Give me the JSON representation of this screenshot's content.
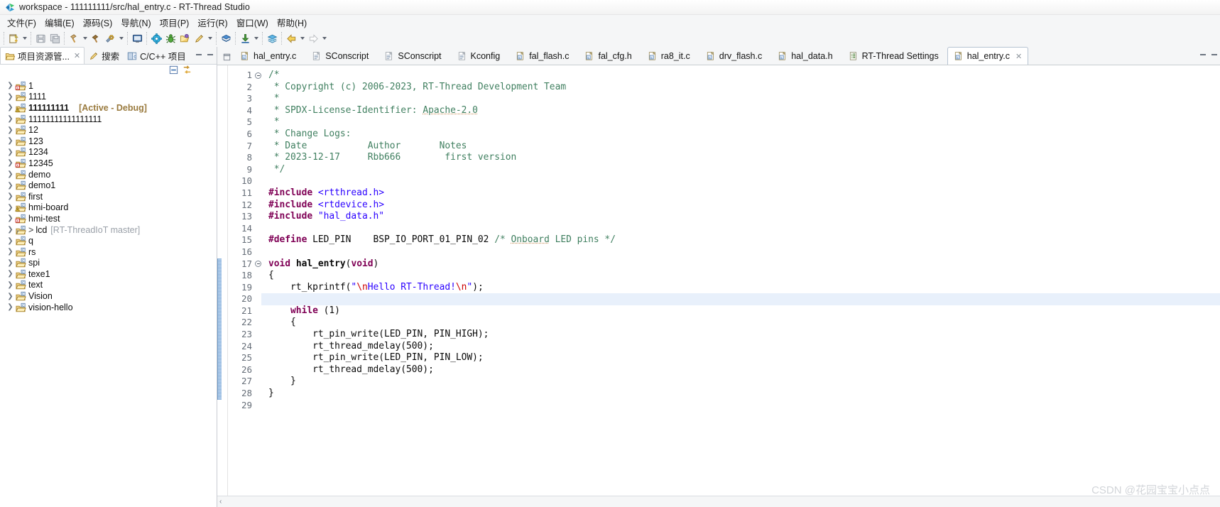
{
  "window": {
    "title": "workspace - 111111111/src/hal_entry.c - RT-Thread Studio",
    "logo_name": "rt-thread-logo-icon"
  },
  "menubar": {
    "items": [
      {
        "label": "文件(F)",
        "name": "menu-file"
      },
      {
        "label": "编辑(E)",
        "name": "menu-edit"
      },
      {
        "label": "源码(S)",
        "name": "menu-source"
      },
      {
        "label": "导航(N)",
        "name": "menu-navigate"
      },
      {
        "label": "项目(P)",
        "name": "menu-project"
      },
      {
        "label": "运行(R)",
        "name": "menu-run"
      },
      {
        "label": "窗口(W)",
        "name": "menu-window"
      },
      {
        "label": "帮助(H)",
        "name": "menu-help"
      }
    ]
  },
  "toolbar": {
    "groups": [
      {
        "buttons": [
          {
            "icon": "new-file-icon",
            "arrow": true
          }
        ]
      },
      {
        "buttons": [
          {
            "icon": "save-icon",
            "arrow": false
          },
          {
            "icon": "save-all-icon",
            "arrow": false
          }
        ]
      },
      {
        "buttons": [
          {
            "icon": "build-hammer-icon",
            "arrow": true
          },
          {
            "icon": "clean-hammer-icon",
            "arrow": false
          },
          {
            "icon": "build-config-icon",
            "arrow": true
          }
        ]
      },
      {
        "buttons": [
          {
            "icon": "terminal-icon",
            "arrow": false
          }
        ]
      },
      {
        "buttons": [
          {
            "icon": "settings-gear-icon",
            "arrow": false
          },
          {
            "icon": "debug-bug-icon",
            "arrow": false
          },
          {
            "icon": "open-package-icon",
            "arrow": false
          },
          {
            "icon": "flash-pen-icon",
            "arrow": true
          }
        ]
      },
      {
        "buttons": [
          {
            "icon": "sdk-manager-icon",
            "arrow": false
          }
        ]
      },
      {
        "buttons": [
          {
            "icon": "download-icon",
            "arrow": true
          }
        ]
      },
      {
        "buttons": [
          {
            "icon": "layers-icon",
            "arrow": false
          }
        ]
      },
      {
        "buttons": [
          {
            "icon": "back-arrow-icon",
            "arrow": true
          },
          {
            "icon": "forward-arrow-icon",
            "arrow": true
          }
        ]
      }
    ]
  },
  "left_pane": {
    "view_tabs": [
      {
        "label": "项目资源管...",
        "icon": "project-explorer-icon",
        "active": true,
        "closable": true
      },
      {
        "label": "搜索",
        "icon": "search-icon",
        "active": false,
        "closable": false
      },
      {
        "label": "C/C++ 项目",
        "icon": "cpp-projects-icon",
        "active": false,
        "closable": false
      }
    ],
    "view_toolbar": [
      {
        "name": "collapse-all-icon"
      },
      {
        "name": "link-with-editor-icon"
      }
    ],
    "minimize_label": "—",
    "tree": [
      {
        "label": "1",
        "icon": "project-error-icon",
        "bold": false,
        "extra": "",
        "prefix": ""
      },
      {
        "label": "1111",
        "icon": "project-icon",
        "bold": false,
        "extra": "",
        "prefix": ""
      },
      {
        "label": "111111111",
        "icon": "project-warning-icon",
        "bold": true,
        "extra": "[Active - Debug]",
        "prefix": ""
      },
      {
        "label": "11111111111111111",
        "icon": "project-icon",
        "bold": false,
        "extra": "",
        "prefix": ""
      },
      {
        "label": "12",
        "icon": "project-icon",
        "bold": false,
        "extra": "",
        "prefix": ""
      },
      {
        "label": "123",
        "icon": "project-icon",
        "bold": false,
        "extra": "",
        "prefix": ""
      },
      {
        "label": "1234",
        "icon": "project-icon",
        "bold": false,
        "extra": "",
        "prefix": ""
      },
      {
        "label": "12345",
        "icon": "project-error-icon",
        "bold": false,
        "extra": "",
        "prefix": ""
      },
      {
        "label": "demo",
        "icon": "project-icon",
        "bold": false,
        "extra": "",
        "prefix": ""
      },
      {
        "label": "demo1",
        "icon": "project-icon",
        "bold": false,
        "extra": "",
        "prefix": ""
      },
      {
        "label": "first",
        "icon": "project-icon",
        "bold": false,
        "extra": "",
        "prefix": ""
      },
      {
        "label": "hmi-board",
        "icon": "project-warning-icon",
        "bold": false,
        "extra": "",
        "prefix": ""
      },
      {
        "label": "hmi-test",
        "icon": "project-error-icon",
        "bold": false,
        "extra": "",
        "prefix": ""
      },
      {
        "label": "lcd",
        "icon": "project-question-icon",
        "bold": false,
        "extra": "[RT-ThreadIoT master]",
        "extra_plain": true,
        "prefix": ">"
      },
      {
        "label": "q",
        "icon": "project-icon",
        "bold": false,
        "extra": "",
        "prefix": ""
      },
      {
        "label": "rs",
        "icon": "project-icon",
        "bold": false,
        "extra": "",
        "prefix": ""
      },
      {
        "label": "spi",
        "icon": "project-icon",
        "bold": false,
        "extra": "",
        "prefix": ""
      },
      {
        "label": "texe1",
        "icon": "project-icon",
        "bold": false,
        "extra": "",
        "prefix": ""
      },
      {
        "label": "text",
        "icon": "project-icon",
        "bold": false,
        "extra": "",
        "prefix": ""
      },
      {
        "label": "Vision",
        "icon": "project-icon",
        "bold": false,
        "extra": "",
        "prefix": ""
      },
      {
        "label": "vision-hello",
        "icon": "project-icon",
        "bold": false,
        "extra": "",
        "prefix": ""
      }
    ]
  },
  "editor": {
    "tabs": [
      {
        "label": "hal_entry.c",
        "icon": "c-file-icon",
        "active": false,
        "closable": false
      },
      {
        "label": "SConscript",
        "icon": "text-file-icon",
        "active": false,
        "closable": false
      },
      {
        "label": "SConscript",
        "icon": "text-file-icon",
        "active": false,
        "closable": false
      },
      {
        "label": "Kconfig",
        "icon": "text-file-icon",
        "active": false,
        "closable": false
      },
      {
        "label": "fal_flash.c",
        "icon": "c-file-icon",
        "active": false,
        "closable": false
      },
      {
        "label": "fal_cfg.h",
        "icon": "c-file-icon",
        "active": false,
        "closable": false
      },
      {
        "label": "ra8_it.c",
        "icon": "c-file-icon",
        "active": false,
        "closable": false
      },
      {
        "label": "drv_flash.c",
        "icon": "c-file-icon",
        "active": false,
        "closable": false
      },
      {
        "label": "hal_data.h",
        "icon": "c-file-icon",
        "active": false,
        "closable": false
      },
      {
        "label": "RT-Thread Settings",
        "icon": "settings-file-icon",
        "active": false,
        "closable": false
      },
      {
        "label": "hal_entry.c",
        "icon": "c-file-icon",
        "active": true,
        "closable": true
      }
    ],
    "current_line": 20,
    "first_line": 1,
    "last_line": 29,
    "scope_from_line": 17,
    "scope_to_line": 28,
    "fold_markers": [
      1,
      17
    ],
    "lines": [
      {
        "n": 1,
        "tokens": [
          {
            "t": "/*",
            "c": "c-comment"
          }
        ]
      },
      {
        "n": 2,
        "tokens": [
          {
            "t": " * Copyright (c) 2006-2023, RT-Thread Development Team",
            "c": "c-comment"
          }
        ]
      },
      {
        "n": 3,
        "tokens": [
          {
            "t": " *",
            "c": "c-comment"
          }
        ]
      },
      {
        "n": 4,
        "tokens": [
          {
            "t": " * SPDX-License-Identifier: ",
            "c": "c-comment"
          },
          {
            "t": "Apache-2.0",
            "c": "c-comment-u"
          }
        ]
      },
      {
        "n": 5,
        "tokens": [
          {
            "t": " *",
            "c": "c-comment"
          }
        ]
      },
      {
        "n": 6,
        "tokens": [
          {
            "t": " * Change Logs:",
            "c": "c-comment"
          }
        ]
      },
      {
        "n": 7,
        "tokens": [
          {
            "t": " * Date           Author       Notes",
            "c": "c-comment"
          }
        ]
      },
      {
        "n": 8,
        "tokens": [
          {
            "t": " * 2023-12-17     Rbb666        first version",
            "c": "c-comment"
          }
        ]
      },
      {
        "n": 9,
        "tokens": [
          {
            "t": " */",
            "c": "c-comment"
          }
        ]
      },
      {
        "n": 10,
        "tokens": [
          {
            "t": "",
            "c": "c-plain"
          }
        ]
      },
      {
        "n": 11,
        "tokens": [
          {
            "t": "#include ",
            "c": "c-prep"
          },
          {
            "t": "<rtthread.h>",
            "c": "c-include"
          }
        ]
      },
      {
        "n": 12,
        "tokens": [
          {
            "t": "#include ",
            "c": "c-prep"
          },
          {
            "t": "<rtdevice.h>",
            "c": "c-include"
          }
        ]
      },
      {
        "n": 13,
        "tokens": [
          {
            "t": "#include ",
            "c": "c-prep"
          },
          {
            "t": "\"hal_data.h\"",
            "c": "c-include"
          }
        ]
      },
      {
        "n": 14,
        "tokens": [
          {
            "t": "",
            "c": "c-plain"
          }
        ]
      },
      {
        "n": 15,
        "tokens": [
          {
            "t": "#define ",
            "c": "c-prep"
          },
          {
            "t": "LED_PIN    BSP_IO_PORT_01_PIN_02 ",
            "c": "c-plain"
          },
          {
            "t": "/* ",
            "c": "c-comment"
          },
          {
            "t": "Onboard",
            "c": "c-comment-u"
          },
          {
            "t": " LED pins */",
            "c": "c-comment"
          }
        ]
      },
      {
        "n": 16,
        "tokens": [
          {
            "t": "",
            "c": "c-plain"
          }
        ]
      },
      {
        "n": 17,
        "tokens": [
          {
            "t": "void ",
            "c": "c-keyword"
          },
          {
            "t": "hal_entry",
            "c": "c-fn"
          },
          {
            "t": "(",
            "c": "c-plain"
          },
          {
            "t": "void",
            "c": "c-keyword"
          },
          {
            "t": ")",
            "c": "c-plain"
          }
        ]
      },
      {
        "n": 18,
        "tokens": [
          {
            "t": "{",
            "c": "c-plain"
          }
        ]
      },
      {
        "n": 19,
        "tokens": [
          {
            "t": "    rt_kprintf(",
            "c": "c-plain"
          },
          {
            "t": "\"",
            "c": "c-string"
          },
          {
            "t": "\\n",
            "c": "c-escape"
          },
          {
            "t": "Hello RT-Thread!",
            "c": "c-string"
          },
          {
            "t": "\\n",
            "c": "c-escape"
          },
          {
            "t": "\"",
            "c": "c-string"
          },
          {
            "t": ");",
            "c": "c-plain"
          }
        ]
      },
      {
        "n": 20,
        "tokens": [
          {
            "t": "",
            "c": "c-plain"
          }
        ]
      },
      {
        "n": 21,
        "tokens": [
          {
            "t": "    ",
            "c": "c-plain"
          },
          {
            "t": "while",
            "c": "c-keyword"
          },
          {
            "t": " (1)",
            "c": "c-plain"
          }
        ]
      },
      {
        "n": 22,
        "tokens": [
          {
            "t": "    {",
            "c": "c-plain"
          }
        ]
      },
      {
        "n": 23,
        "tokens": [
          {
            "t": "        rt_pin_write(LED_PIN, PIN_HIGH);",
            "c": "c-plain"
          }
        ]
      },
      {
        "n": 24,
        "tokens": [
          {
            "t": "        rt_thread_mdelay(500);",
            "c": "c-plain"
          }
        ]
      },
      {
        "n": 25,
        "tokens": [
          {
            "t": "        rt_pin_write(LED_PIN, PIN_LOW);",
            "c": "c-plain"
          }
        ]
      },
      {
        "n": 26,
        "tokens": [
          {
            "t": "        rt_thread_mdelay(500);",
            "c": "c-plain"
          }
        ]
      },
      {
        "n": 27,
        "tokens": [
          {
            "t": "    }",
            "c": "c-plain"
          }
        ]
      },
      {
        "n": 28,
        "tokens": [
          {
            "t": "}",
            "c": "c-plain"
          }
        ]
      },
      {
        "n": 29,
        "tokens": [
          {
            "t": "",
            "c": "c-plain"
          }
        ]
      }
    ]
  },
  "watermark": "CSDN @花园宝宝小点点",
  "colors": {
    "accent": "#3f7f5f",
    "keyword": "#7f0055",
    "string": "#2a00ff",
    "escape": "#cc0000",
    "current_line": "#e8f0fb",
    "chrome": "#f5f6f7"
  }
}
